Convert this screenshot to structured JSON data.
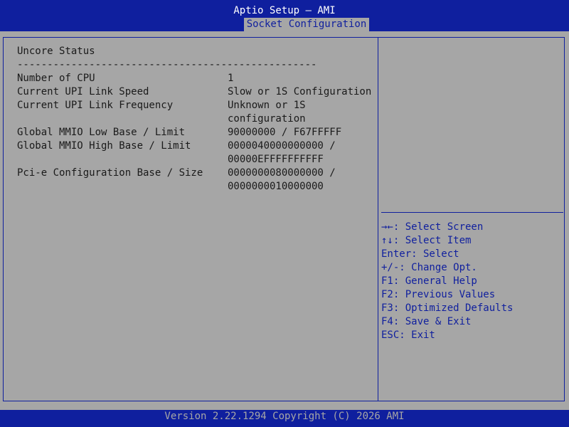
{
  "header": {
    "title": "Aptio Setup – AMI",
    "tab": "Socket Configuration"
  },
  "left": {
    "section_title": "Uncore Status",
    "separator": "--------------------------------------------------",
    "rows": [
      {
        "label": "Number of CPU",
        "value": [
          "1"
        ]
      },
      {
        "label": "Current UPI Link Speed",
        "value": [
          "Slow or 1S Configuration"
        ]
      },
      {
        "label": "Current UPI Link Frequency",
        "value": [
          "Unknown or 1S",
          "configuration"
        ]
      },
      {
        "label": "Global MMIO Low Base / Limit",
        "value": [
          "90000000 / F67FFFFF"
        ]
      },
      {
        "label": "Global MMIO High Base / Limit",
        "value": [
          "0000040000000000 /",
          "00000EFFFFFFFFFF"
        ]
      },
      {
        "label": "Pci-e Configuration Base / Size",
        "value": [
          "0000000080000000 /",
          "0000000010000000"
        ]
      }
    ]
  },
  "help": [
    "→←: Select Screen",
    "↑↓: Select Item",
    "Enter: Select",
    "+/-: Change Opt.",
    "F1: General Help",
    "F2: Previous Values",
    "F3: Optimized Defaults",
    "F4: Save & Exit",
    "ESC: Exit"
  ],
  "footer": {
    "text": "Version 2.22.1294 Copyright (C) 2026 AMI"
  },
  "colors": {
    "bios_blue": "#0f1f9e",
    "panel_gray": "#a6a6a6",
    "text_dark": "#1a1a1a",
    "header_text": "#ffffff"
  }
}
